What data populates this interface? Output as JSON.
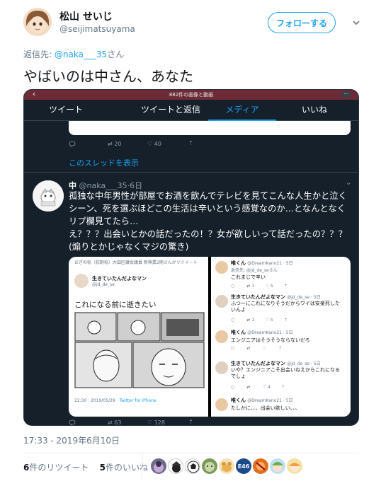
{
  "author": {
    "name": "松山 せいじ",
    "handle": "@seijimatsuyama"
  },
  "follow_label": "フォローする",
  "reply_prefix": "返信先: ",
  "reply_handle": "@naka___35",
  "reply_suffix": "さん",
  "tweet_text": "やばいのは中さん、あなた",
  "screenshot": {
    "top_label": "882件の画像と動画",
    "tabs": [
      "ツイート",
      "ツイートと返信",
      "メディア",
      "いいね"
    ],
    "active_tab": "メディア",
    "prev_actions": {
      "retweets": "20",
      "likes": "40"
    },
    "thread_link": "このスレッドを表示",
    "tweet2": {
      "name": "中",
      "meta": "@naka___35·6日",
      "lines": [
        "孤独な中年男性が部屋でお酒を飲んでテレビを見てこんな人生かと泣く",
        "シーン、死を選ぶほどこの生活は辛いという感覚なのか…となんとなく",
        "リプ欄見てたら…",
        "え？？？出会いとかの話だったの！？女が欲しいって話だったの？？？",
        "(煽りとかじゃなくマジの驚き)"
      ],
      "actions": {
        "retweets": "63",
        "likes": "128"
      }
    },
    "left_image": {
      "rt_note": "おぎの稔（荻野稔）大田区議会議員 新興異2期さんがリツイート",
      "name": "生きていたんだよなマン",
      "handle": "@jd_de_se",
      "text": "これになる前に逝きたい",
      "footer_time": "22:30 · 2019/05/29 · ",
      "footer_app": "Twitter for iPhone"
    },
    "right_image": {
      "replies": [
        {
          "name": "唯くん",
          "meta": "@DreamKano21 · 5日",
          "reply_to": "返信先: @jd_de_seさん",
          "text": "これまじで辛い",
          "rt": "1",
          "likes": "5"
        },
        {
          "name": "生きていたんだよなマン",
          "meta": "@jd_de_se · 5日",
          "text": "ふつーにこれになりそうだからワイは安楽死したいんよ",
          "rt": "1",
          "likes": "5"
        },
        {
          "name": "唯くん",
          "meta": "@DreamKano21 · 5日",
          "text": "エンジニアはそうそうならないだろ",
          "rt": "",
          "likes": ""
        },
        {
          "name": "生きていたんだよなマン",
          "meta": "@jd_de_se · 5日",
          "text": "いや？エンジニアこそ出会いねえからこれになるでしょ",
          "rt": "",
          "likes": "4"
        },
        {
          "name": "唯くん",
          "meta": "@DreamKano21 · 5日",
          "text": "たしかに、、、出会い欲しい、、、",
          "rt": "",
          "likes": ""
        }
      ]
    }
  },
  "timestamp": "17:33 - 2019年6月10日",
  "stats": {
    "retweets_num": "6",
    "retweets_label": "件のリツイート",
    "likes_num": "5",
    "likes_label": "件のいいね"
  },
  "likers": [
    "liker-1",
    "liker-2",
    "liker-3",
    "liker-4",
    "liker-5",
    "liker-6",
    "liker-7",
    "liker-8",
    "liker-9"
  ],
  "liker_badge": "E46",
  "colors": {
    "accent": "#1da1f2",
    "dark_bg": "#15202b",
    "muted": "#657786"
  }
}
